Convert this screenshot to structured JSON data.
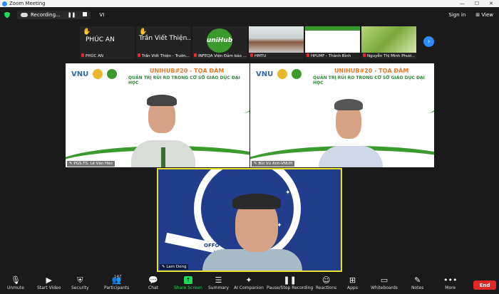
{
  "window": {
    "title": "Zoom Meeting"
  },
  "topbar": {
    "recording_label": "Recording...",
    "language": "VI",
    "signin": "Sign in",
    "view": "View"
  },
  "gallery_strip": [
    {
      "big_label": "PHÚC AN",
      "name": "PHÚC AN",
      "hand": true
    },
    {
      "big_label": "Trần Viết Thiện...",
      "name": "Trần Viết Thiện - Trườn...",
      "hand": true
    },
    {
      "big_label": "uniHub",
      "name": "INFEQA Viện Đảm bảo ...",
      "hand": false
    },
    {
      "big_label": "",
      "name": "HMTU",
      "hand": false
    },
    {
      "big_label": "",
      "name": "HPUMF - Thành Bình",
      "hand": false
    },
    {
      "big_label": "",
      "name": "Nguyễn Thị Minh Phươ...",
      "hand": false
    }
  ],
  "slide": {
    "org": "VNU",
    "org2": "INFEQA",
    "event_title": "UNIHUB#20 - TỌA ĐÀM",
    "event_subtitle": "QUẢN TRỊ RỦI RO TRONG CƠ SỞ GIÁO DỤC ĐẠI HỌC"
  },
  "panelists": [
    {
      "name": "PGS.TS. Lê Văn Hảo"
    },
    {
      "name": "Bùi Vũ Anh-VNUH"
    }
  ],
  "active_speaker": {
    "name": "Lam Dong",
    "crest_text": "OFFO"
  },
  "toolbar": {
    "items": [
      {
        "label": "Unmute",
        "icon": "mic-muted-icon"
      },
      {
        "label": "Start Video",
        "icon": "video-off-icon"
      },
      {
        "label": "Security",
        "icon": "shield-icon"
      },
      {
        "label": "Participants",
        "icon": "participants-icon",
        "count": "147"
      },
      {
        "label": "Chat",
        "icon": "chat-icon"
      },
      {
        "label": "Share Screen",
        "icon": "share-screen-icon"
      },
      {
        "label": "Summary",
        "icon": "summary-icon"
      },
      {
        "label": "AI Companion",
        "icon": "ai-companion-icon"
      },
      {
        "label": "Pause/Stop Recording",
        "icon": "pause-recording-icon"
      },
      {
        "label": "Reactions",
        "icon": "reactions-icon"
      },
      {
        "label": "Apps",
        "icon": "apps-icon"
      },
      {
        "label": "Whiteboards",
        "icon": "whiteboard-icon"
      },
      {
        "label": "Notes",
        "icon": "notes-icon"
      },
      {
        "label": "More",
        "icon": "more-icon"
      }
    ],
    "end_label": "End"
  },
  "colors": {
    "accent": "#2d8cff",
    "share": "#23d959",
    "end": "#e02828",
    "speaker_border": "#e8e02a"
  }
}
